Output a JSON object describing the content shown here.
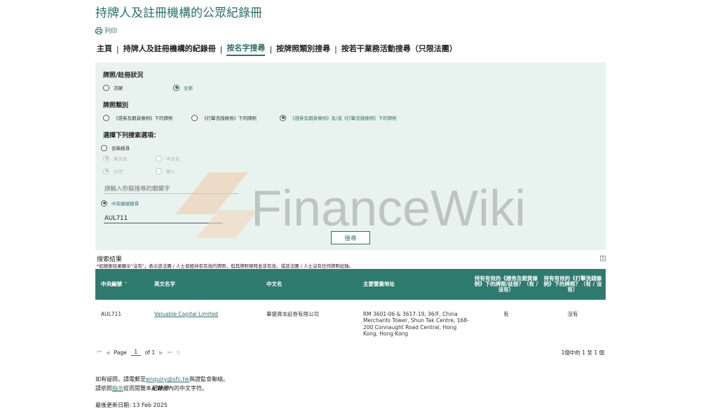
{
  "header": {
    "title": "持牌人及註冊機構的公眾紀錄冊",
    "print_label": "列印"
  },
  "nav": {
    "items": [
      {
        "label": "主頁"
      },
      {
        "label": "持牌人及註冊機構的紀錄冊"
      },
      {
        "label": "按名字搜尋"
      },
      {
        "label": "按牌照類別搜尋"
      },
      {
        "label": "按若干業務活動搜尋（只限法團）"
      }
    ],
    "separator": "|"
  },
  "search": {
    "status_label": "牌照/註冊狀況",
    "status_options": [
      "活躍",
      "全部"
    ],
    "license_label": "牌照類別",
    "license_options": [
      "《證券及期貨條例》下的牌照",
      "《打擊洗錢條例》下的牌照",
      "《證券及期貨條例》及/或《打擊洗錢條例》下的牌照"
    ],
    "select_label": "選擇下列搜索選項：",
    "name_search_label": "名稱搜尋",
    "lang_options": [
      "英文名",
      "中文名"
    ],
    "type_options": [
      "公司",
      "個人"
    ],
    "keyword_placeholder": "請輸入你擬搜尋的關鍵字",
    "ce_search_label": "中央編號搜尋",
    "ce_value": "AUL711",
    "search_button": "搜尋"
  },
  "watermark": {
    "text": "FinanceWiki"
  },
  "results": {
    "title": "搜索結果",
    "note": "*如搜索結果顯示\"沒有\"，表示該法團 / 人士曾經持有有效的牌照，但其牌照現時並非有效，或該法團 / 人士沒有任何牌照紀錄。",
    "collapse_symbol": "⊼",
    "columns": [
      "中央編號",
      "英文名字",
      "中文名",
      "主要營業地址",
      "持有有效的《證券及期貨條例》下的牌照/註冊？（有 / 沒有）",
      "持有有效的《打擊洗錢條例》下的牌照？（有 / 沒有）"
    ],
    "rows": [
      {
        "ce": "AUL711",
        "en_name": "Valuable Capital Limited",
        "cn_name": "華盛資本証券有限公司",
        "address": "RM 3601-06 & 3617-19, 36/F, China Merchants Tower, Shun Tak Centre, 168-200 Connaught Road Central, Hong Kong, Hong Kong",
        "sfo": "有",
        "amlo": "沒有"
      }
    ]
  },
  "pager": {
    "first": "⏮",
    "prev": "◀",
    "page_label": "Page",
    "page_value": "1",
    "of_label": "of 1",
    "next": "▶",
    "last": "⏭",
    "refresh": "↻",
    "summary": "1個中的 1 至 1 個"
  },
  "footer": {
    "contact_prefix": "如有疑問，請電郵至",
    "contact_email": "enquiry@sfc.hk",
    "contact_suffix": "與證監會聯絡。",
    "guide_prefix": "請依照",
    "guide_link": "指示",
    "guide_middle": "從而閱覽本",
    "guide_italic": "紀錄冊",
    "guide_suffix": "內的中文字符。",
    "last_updated": "最後更新日期: 13 Feb 2025"
  },
  "colors": {
    "accent": "#2f6f6a",
    "table_header": "#2f7a6f",
    "panel_bg": "#e8f3f0"
  }
}
